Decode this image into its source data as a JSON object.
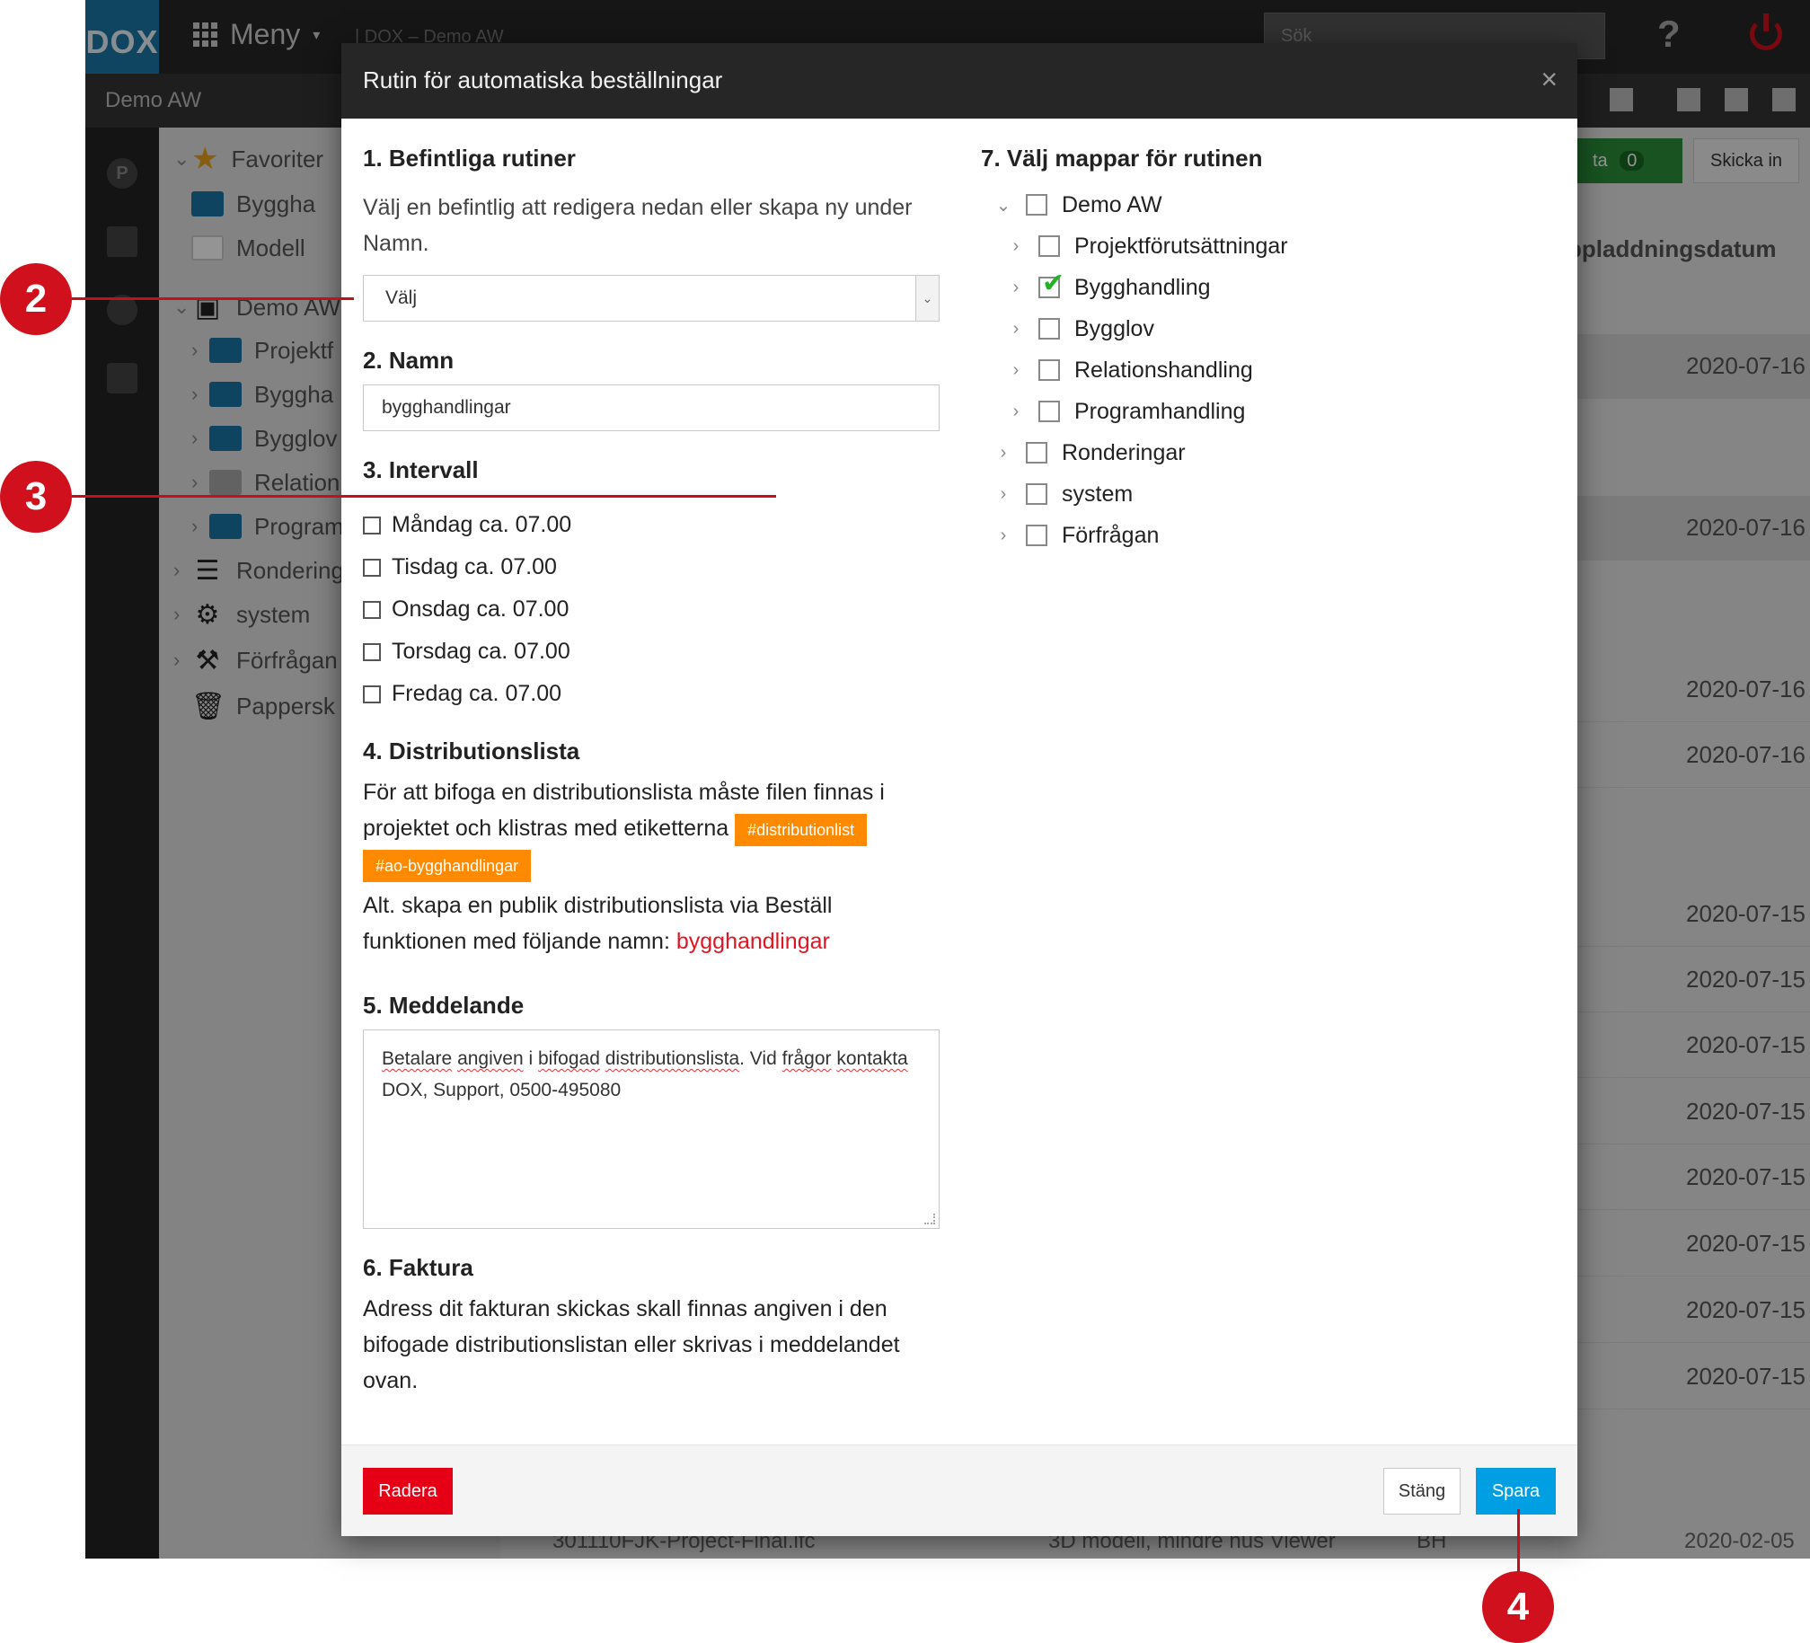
{
  "app": {
    "logo": "DOX",
    "menu_label": "Meny",
    "breadcrumb": "| DOX – Demo AW",
    "search_placeholder": "Sök",
    "help": "?",
    "project_title": "Demo AW",
    "send_button": "Skicka in",
    "green_button": "ta",
    "green_count": "0",
    "sort_header": "ppladdningsdatum",
    "sidebar": [
      {
        "label": "Favoriter",
        "type": "star"
      },
      {
        "label": "Byggha",
        "type": "folder"
      },
      {
        "label": "Modell",
        "type": "folder-white"
      },
      {
        "label": "Demo AW",
        "type": "archive"
      },
      {
        "label": "Projektf",
        "type": "folder"
      },
      {
        "label": "Byggha",
        "type": "folder"
      },
      {
        "label": "Bygglov",
        "type": "folder"
      },
      {
        "label": "Relation",
        "type": "folder-grey"
      },
      {
        "label": "Program",
        "type": "folder"
      },
      {
        "label": "Rondering",
        "type": "list"
      },
      {
        "label": "system",
        "type": "gear"
      },
      {
        "label": "Förfrågan",
        "type": "hammer"
      },
      {
        "label": "Pappersk",
        "type": "trash"
      }
    ],
    "dates": [
      "2020-07-16",
      "2020-07-16",
      "2020-07-16",
      "2020-07-16",
      "2020-07-15",
      "2020-07-15",
      "2020-07-15",
      "2020-07-15",
      "2020-07-15",
      "2020-07-15",
      "2020-07-15",
      "2020-07-15"
    ],
    "bottom_row": {
      "file": "301110FJK-Project-Final.ifc",
      "description": "3D modell, mindre hus Viewer",
      "code": "BH",
      "date": "2020-02-05"
    }
  },
  "modal": {
    "title": "Rutin för automatiska beställningar",
    "close": "×",
    "section1": {
      "title": "1. Befintliga rutiner",
      "text": "Välj en befintlig att redigera nedan eller skapa ny under Namn.",
      "select_value": "Välj"
    },
    "section2": {
      "title": "2. Namn",
      "value": "bygghandlingar"
    },
    "section3": {
      "title": "3. Intervall",
      "days": [
        "Måndag ca. 07.00",
        "Tisdag ca. 07.00",
        "Onsdag ca. 07.00",
        "Torsdag ca. 07.00",
        "Fredag ca. 07.00"
      ]
    },
    "section4": {
      "title": "4. Distributionslista",
      "text": "För att bifoga en distributionslista måste filen finnas i projektet och klistras med etiketterna",
      "tag1": "#distributionlist",
      "tag2": "#ao-bygghandlingar",
      "alt_text": "Alt. skapa en publik distributionslista via Beställ funktionen med följande namn:",
      "link": "bygghandlingar"
    },
    "section5": {
      "title": "5. Meddelande",
      "message_part1": "Betalare",
      "message_part2": "angiven",
      "message_part3": "i",
      "message_part4": "bifogad",
      "message_part5": "distributionslista",
      "message_part6": ". Vid",
      "message_part7": "frågor",
      "message_part8": "kontakta",
      "message_part9": " DOX, Support, 0500-495080"
    },
    "section6": {
      "title": "6. Faktura",
      "text": "Adress dit fakturan skickas skall finnas angiven i den bifogade distributionslistan eller skrivas i meddelandet ovan."
    },
    "section7": {
      "title": "7. Välj mappar för rutinen",
      "folders": [
        {
          "label": "Demo AW",
          "expanded": true,
          "checked": false
        },
        {
          "label": "Projektförutsättningar",
          "checked": false
        },
        {
          "label": "Bygghandling",
          "checked": true
        },
        {
          "label": "Bygglov",
          "checked": false
        },
        {
          "label": "Relationshandling",
          "checked": false
        },
        {
          "label": "Programhandling",
          "checked": false
        },
        {
          "label": "Ronderingar",
          "checked": false
        },
        {
          "label": "system",
          "checked": false
        },
        {
          "label": "Förfrågan",
          "checked": false
        }
      ]
    },
    "buttons": {
      "delete": "Radera",
      "close": "Stäng",
      "save": "Spara"
    }
  },
  "callouts": [
    "2",
    "3",
    "4"
  ]
}
